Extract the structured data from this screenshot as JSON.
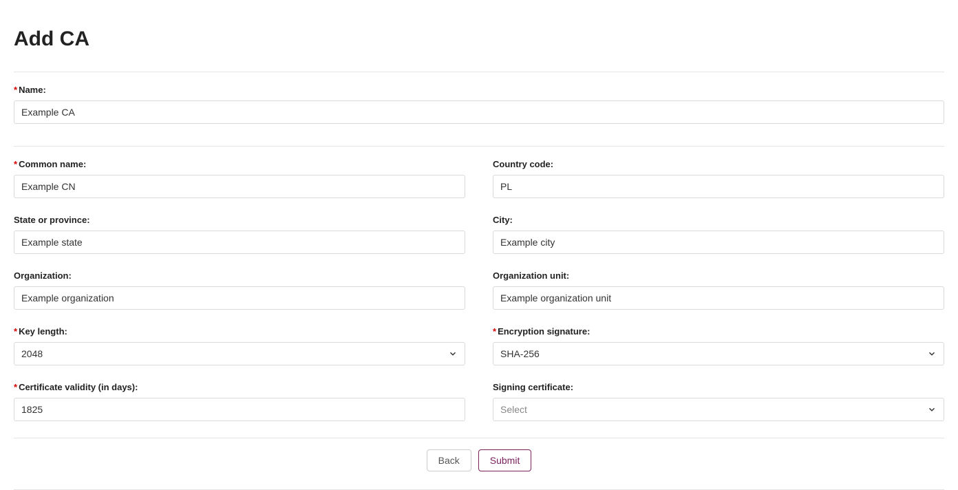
{
  "page_title": "Add CA",
  "form": {
    "name": {
      "label": "Name:",
      "value": "Example CA",
      "required": true
    },
    "common_name": {
      "label": "Common name:",
      "value": "Example CN",
      "required": true
    },
    "country_code": {
      "label": "Country code:",
      "value": "PL",
      "required": false
    },
    "state": {
      "label": "State or province:",
      "value": "Example state",
      "required": false
    },
    "city": {
      "label": "City:",
      "value": "Example city",
      "required": false
    },
    "organization": {
      "label": "Organization:",
      "value": "Example organization",
      "required": false
    },
    "organization_unit": {
      "label": "Organization unit:",
      "value": "Example organization unit",
      "required": false
    },
    "key_length": {
      "label": "Key length:",
      "value": "2048",
      "required": true
    },
    "encryption_signature": {
      "label": "Encryption signature:",
      "value": "SHA-256",
      "required": true
    },
    "certificate_validity": {
      "label": "Certificate validity (in days):",
      "value": "1825",
      "required": true
    },
    "signing_certificate": {
      "label": "Signing certificate:",
      "placeholder": "Select",
      "required": false
    }
  },
  "buttons": {
    "back": "Back",
    "submit": "Submit"
  },
  "required_mark": "*"
}
